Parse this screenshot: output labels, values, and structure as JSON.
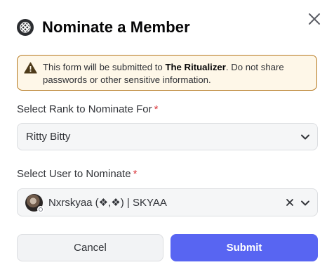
{
  "modal": {
    "title": "Nominate a Member",
    "app_icon": "celtic-knot-icon",
    "close_icon": "close-icon"
  },
  "warning": {
    "icon": "warning-triangle-icon",
    "text_before": "This form will be submitted to ",
    "app_name": "The Ritualizer",
    "text_after": ". Do not share passwords or other sensitive information."
  },
  "rank_field": {
    "label": "Select Rank to Nominate For",
    "required_marker": "*",
    "value": "Ritty Bitty",
    "chevron_icon": "chevron-down-icon"
  },
  "user_field": {
    "label": "Select User to Nominate",
    "required_marker": "*",
    "value": "Nxrskyaa (❖,❖) | SKYAA",
    "clear_icon": "clear-x-icon",
    "chevron_icon": "chevron-down-icon"
  },
  "buttons": {
    "cancel": "Cancel",
    "submit": "Submit"
  },
  "colors": {
    "accent": "#5865f2",
    "warning_border": "#b5781e",
    "warning_bg": "#fef7e8",
    "required": "#da373c"
  }
}
